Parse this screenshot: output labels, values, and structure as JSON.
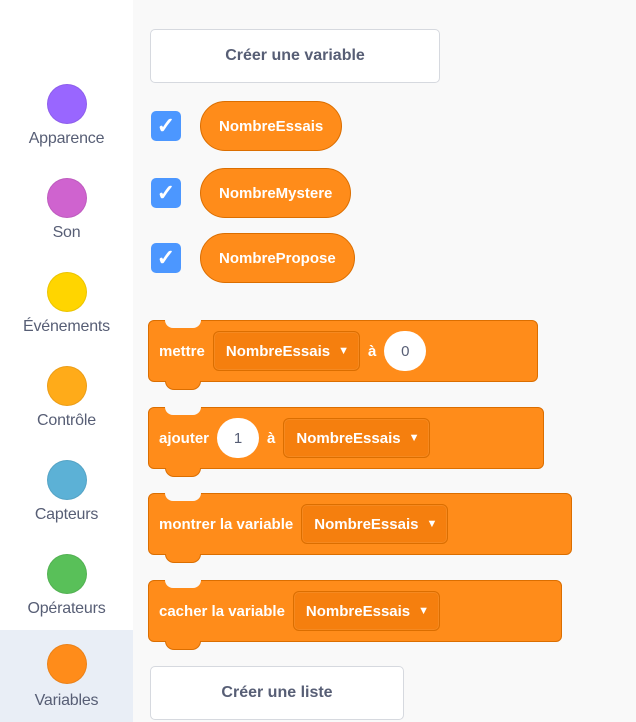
{
  "categories": [
    {
      "label": "Apparence",
      "color": "#9966ff"
    },
    {
      "label": "Son",
      "color": "#cf63cf"
    },
    {
      "label": "Événements",
      "color": "#ffd500"
    },
    {
      "label": "Contrôle",
      "color": "#ffab19"
    },
    {
      "label": "Capteurs",
      "color": "#5cb1d6"
    },
    {
      "label": "Opérateurs",
      "color": "#59c059"
    },
    {
      "label": "Variables",
      "color": "#ff8c1a",
      "selected": true
    }
  ],
  "palette": {
    "create_variable_label": "Créer une variable",
    "create_list_label": "Créer une liste",
    "variables": [
      {
        "name": "NombreEssais",
        "checked": true
      },
      {
        "name": "NombreMystere",
        "checked": true
      },
      {
        "name": "NombrePropose",
        "checked": true
      }
    ],
    "blocks": {
      "set": {
        "text": "mettre",
        "variable": "NombreEssais",
        "to": "à",
        "value": "0"
      },
      "change": {
        "text": "ajouter",
        "value": "1",
        "to": "à",
        "variable": "NombreEssais"
      },
      "show": {
        "text": "montrer la variable",
        "variable": "NombreEssais"
      },
      "hide": {
        "text": "cacher la variable",
        "variable": "NombreEssais"
      }
    }
  },
  "icons": {
    "checkbox": "checkmark-icon",
    "dropdown": "caret-down-icon"
  }
}
